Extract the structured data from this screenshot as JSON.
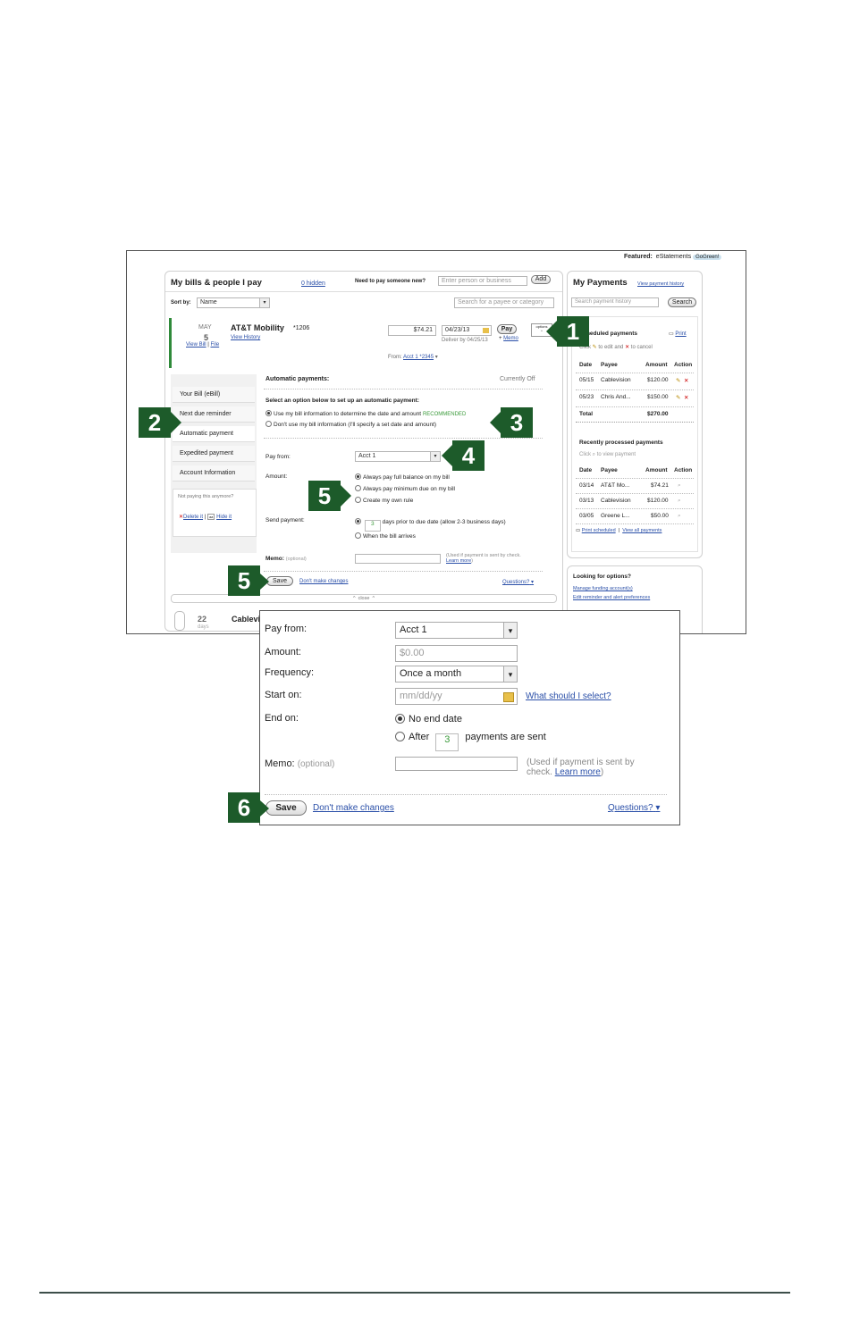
{
  "top_bar": {
    "featured_label": "Featured:",
    "featured_item": "eStatements",
    "featured_badge": "GoGreen!"
  },
  "bills": {
    "title": "My bills & people I pay",
    "hidden_link": "0 hidden",
    "pay_new_label": "Need to pay someone new?",
    "pay_new_placeholder": "Enter person or business",
    "add_button": "Add",
    "sort_label": "Sort by:",
    "sort_value": "Name",
    "search_placeholder": "Search for a payee or category",
    "att": {
      "month": "MAY",
      "day": "5",
      "view_bill": "View Bill",
      "file": "File",
      "name": "AT&T Mobility",
      "acct": "*1206",
      "view_history": "View History",
      "amount": "$74.21",
      "date": "04/23/13",
      "deliver_by": "Deliver by 04/25/13",
      "pay_button": "Pay",
      "memo_link": "Memo",
      "options": "options",
      "from_label": "From:",
      "from_link": "Acct 1 *2345"
    },
    "nav": [
      {
        "label": "Your Bill (eBill)"
      },
      {
        "label": "Next due reminder"
      },
      {
        "label": "Automatic payment"
      },
      {
        "label": "Expedited payment"
      },
      {
        "label": "Account Information"
      }
    ],
    "not_paying": "Not paying this anymore?",
    "delete_link": "Delete it",
    "hide_link": "Hide it",
    "auto": {
      "title": "Automatic payments:",
      "status": "Currently Off",
      "prompt": "Select an option below to set up an automatic payment:",
      "option1": "Use my bill information to determine the date and amount",
      "recommended": "RECOMMENDED",
      "option2": "Don't use my bill information (I'll specify a set date and amount)",
      "pay_from_label": "Pay from:",
      "pay_from_value": "Acct 1",
      "amount_label": "Amount:",
      "amount_opt1": "Always pay full balance on my bill",
      "amount_opt2": "Always pay minimum due on my bill",
      "amount_opt3": "Create my own rule",
      "send_label": "Send payment:",
      "send_days": "3",
      "send_opt1": "days prior to due date (allow 2-3 business days)",
      "send_opt2": "When the bill arrives",
      "memo_label": "Memo:",
      "memo_optional": "(optional)",
      "memo_note": "(Used if payment is sent by check.",
      "learn_more": "Learn more",
      "save": "Save",
      "dont_save": "Don't make changes",
      "questions": "Questions?",
      "close": "close"
    },
    "cable": {
      "day": "22",
      "days": "days",
      "name": "Cablevi"
    }
  },
  "payments": {
    "title": "My Payments",
    "history_link": "View payment history",
    "search_placeholder": "Search payment history",
    "search_button": "Search",
    "scheduled_title": "Scheduled payments",
    "print": "Print",
    "scheduled_hint_a": "Click",
    "scheduled_hint_b": "to edit and",
    "scheduled_hint_c": "to cancel",
    "headers": [
      "Date",
      "Payee",
      "Amount",
      "Action"
    ],
    "scheduled": [
      {
        "date": "05/15",
        "payee": "Cablevision",
        "amount": "$120.00"
      },
      {
        "date": "05/23",
        "payee": "Chris And...",
        "amount": "$150.00"
      }
    ],
    "total_label": "Total",
    "total_value": "$270.00",
    "recent_title": "Recently processed payments",
    "recent_hint": "Click",
    "recent_hint_b": "to view payment",
    "recent": [
      {
        "date": "03/14",
        "payee": "AT&T Mo...",
        "amount": "$74.21"
      },
      {
        "date": "03/13",
        "payee": "Cablevision",
        "amount": "$120.00"
      },
      {
        "date": "03/05",
        "payee": "Greene L...",
        "amount": "$50.00"
      }
    ],
    "print_scheduled": "Print scheduled",
    "view_all": "View all payments"
  },
  "options": {
    "title": "Looking for options?",
    "link1": "Manage funding account(s)",
    "link2": "Edit reminder and alert preferences"
  },
  "zoom": {
    "pay_from_label": "Pay from:",
    "pay_from_value": "Acct 1",
    "amount_label": "Amount:",
    "amount_placeholder": "$0.00",
    "frequency_label": "Frequency:",
    "frequency_value": "Once a month",
    "start_label": "Start on:",
    "start_placeholder": "mm/dd/yy",
    "what_select": "What should I select?",
    "end_label": "End on:",
    "end_opt1": "No end date",
    "end_opt2": "After",
    "after_count": "3",
    "after_suffix": "payments are sent",
    "memo_label": "Memo:",
    "memo_optional": "(optional)",
    "memo_note_a": "(Used if payment is sent by",
    "memo_note_b": "check.",
    "learn_more": "Learn more",
    "save": "Save",
    "dont_save": "Don't make changes",
    "questions": "Questions?"
  },
  "callouts": [
    "1",
    "2",
    "3",
    "4",
    "5",
    "5",
    "6"
  ],
  "colors": {
    "callout": "#1d5b2a",
    "link": "#2a4fa8",
    "recommended": "#3a9a3a"
  }
}
